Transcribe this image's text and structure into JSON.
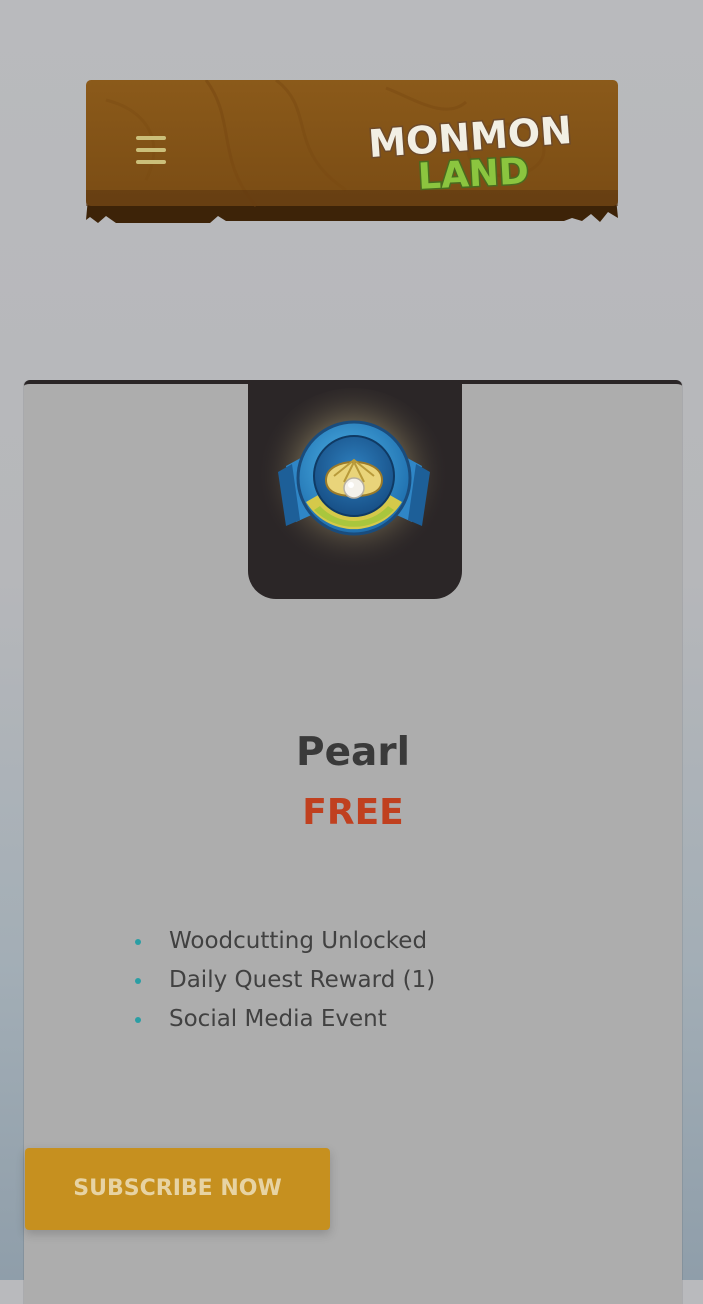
{
  "header": {
    "logo_line1": "MONMON",
    "logo_line2": "LAND"
  },
  "tier": {
    "name": "Pearl",
    "price": "FREE",
    "badge_icon": "pearl-shell-badge",
    "features": [
      "Woodcutting Unlocked",
      "Daily Quest Reward (1)",
      "Social Media Event"
    ]
  },
  "cta": {
    "label": "SUBSCRIBE NOW"
  },
  "colors": {
    "wood": "#8a5718",
    "card": "#adadad",
    "price": "#c0401f",
    "bullet": "#2a9ea4",
    "button": "#c6901f"
  }
}
